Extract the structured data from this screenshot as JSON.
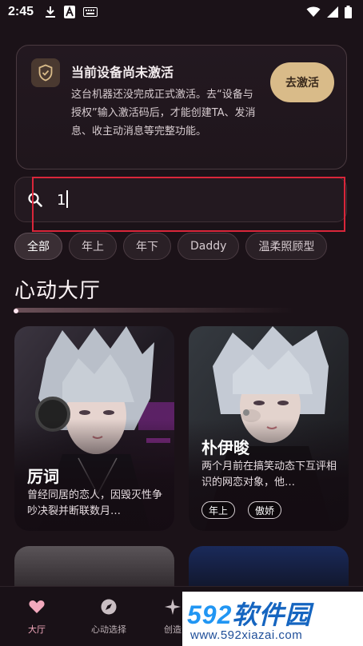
{
  "status_bar": {
    "time": "2:45",
    "left_icons": [
      "download-icon",
      "text-a-icon",
      "keyboard-icon"
    ],
    "right_icons": [
      "wifi-icon",
      "cellular-icon",
      "battery-icon"
    ]
  },
  "activation": {
    "title": "当前设备尚未激活",
    "description": "这台机器还没完成正式激活。去“设备与授权”输入激活码后，才能创建TA、发消息、收主动消息等完整功能。",
    "button_label": "去激活",
    "icon": "shield-check-icon"
  },
  "search": {
    "value": "1",
    "icon": "search-icon"
  },
  "filters": [
    "全部",
    "年上",
    "年下",
    "Daddy",
    "温柔照顾型"
  ],
  "section_title": "心动大厅",
  "cards": [
    {
      "name": "厉词",
      "description": "曾经同居的恋人，因毁灭性争吵决裂并断联数月…",
      "tags": []
    },
    {
      "name": "朴伊晙",
      "description": "两个月前在搞笑动态下互评相识的网恋对象，他…",
      "tags": [
        "年上",
        "傲娇"
      ]
    }
  ],
  "bottom_nav": [
    {
      "label": "大厅",
      "icon": "heart-icon",
      "active": true
    },
    {
      "label": "心动选择",
      "icon": "compass-icon",
      "active": false
    },
    {
      "label": "创造",
      "icon": "sparkle-icon",
      "active": false
    }
  ],
  "watermark": {
    "main_prefix": "592",
    "main_suffix": "软件园",
    "url": "www.592xiazai.com"
  },
  "colors": {
    "background": "#1b1218",
    "accent_gold": "#d9bb89",
    "highlight_red": "#d9263a",
    "nav_active": "#f3a9bd"
  }
}
